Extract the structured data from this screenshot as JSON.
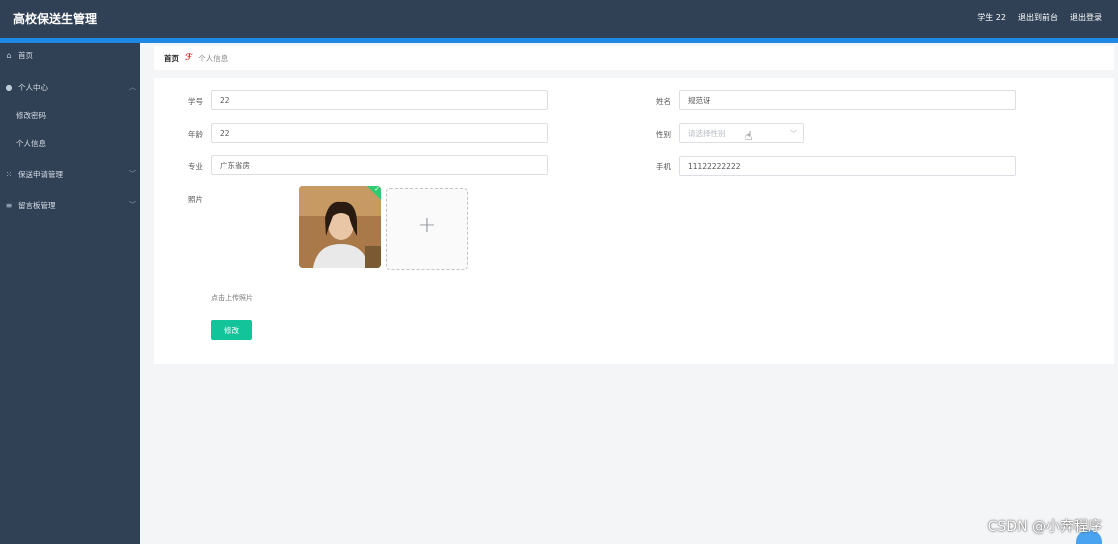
{
  "app": {
    "title": "高校保送生管理"
  },
  "header": {
    "user": "学生 22",
    "back_to_front": "退出到前台",
    "logout": "退出登录"
  },
  "sidebar": {
    "items": [
      {
        "label": "首页",
        "icon": "home-icon"
      },
      {
        "label": "个人中心",
        "icon": "user-icon",
        "expanded": true
      },
      {
        "label": "修改密码",
        "sub": true
      },
      {
        "label": "个人信息",
        "sub": true
      },
      {
        "label": "保送申请管理",
        "icon": "list-icon"
      },
      {
        "label": "留言板管理",
        "icon": "menu-icon"
      }
    ]
  },
  "breadcrumb": {
    "home": "首页",
    "current": "个人信息"
  },
  "form": {
    "student_id_label": "学号",
    "student_id_value": "22",
    "name_label": "姓名",
    "name_value": "规范讶",
    "age_label": "年龄",
    "age_value": "22",
    "gender_label": "性别",
    "gender_placeholder": "请选择性别",
    "major_label": "专业",
    "major_value": "广东省房",
    "phone_label": "手机",
    "phone_value": "11122222222",
    "photo_label": "照片",
    "upload_hint": "点击上传照片",
    "submit_label": "修改"
  },
  "watermark": "CSDN @小奔程序",
  "colors": {
    "sidebar": "#304156",
    "accent": "#1e88e5",
    "submit": "#13c49a"
  }
}
